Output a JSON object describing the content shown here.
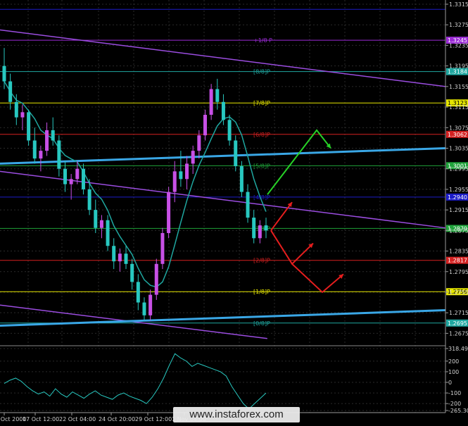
{
  "chart_data": [
    {
      "type": "candlestick",
      "instrument_panel": "price",
      "title": "",
      "ylim": [
        1.2655,
        1.3315
      ],
      "y_ticks": [
        "1.3315",
        "1.3275",
        "1.3235",
        "1.3195",
        "1.3155",
        "1.3115",
        "1.3075",
        "1.3035",
        "1.2995",
        "1.2955",
        "1.2915",
        "1.2875",
        "1.2835",
        "1.2795",
        "1.2755",
        "1.2715",
        "1.2675"
      ],
      "x_tick_labels": [
        "16 Oct 2000",
        "17 Oct 12:00",
        "22 Oct 04:00",
        "24 Oct 20:00",
        "29 Oct 12:00",
        "1 Nov 04:00"
      ],
      "price_levels": [
        {
          "label": "",
          "value": 1.3305,
          "color": "#1c1cc8",
          "badge": ""
        },
        {
          "label": "+1/8 P",
          "value": 1.3245,
          "color": "#9b2bd6",
          "badge": "1.3245"
        },
        {
          "label": "[8/8]P",
          "value": 1.3184,
          "color": "#1fa7a0",
          "badge": "1.3184"
        },
        {
          "label": "[7/8]P",
          "value": 1.3123,
          "color": "#e6e600",
          "badge": "1.3123"
        },
        {
          "label": "[6/8]P",
          "value": 1.3062,
          "color": "#d42020",
          "badge": "1.3062"
        },
        {
          "label": "[5/8]P",
          "value": 1.3001,
          "color": "#1fa33a",
          "badge": "1.3001"
        },
        {
          "label": "[4/8]P",
          "value": 1.294,
          "color": "#1c1cc8",
          "badge": "1.2940"
        },
        {
          "label": "[3/8]P",
          "value": 1.2879,
          "color": "#1fa33a",
          "badge": "1.2879"
        },
        {
          "label": "[2/8]P",
          "value": 1.2817,
          "color": "#d42020",
          "badge": "1.2817"
        },
        {
          "label": "[1/8]P",
          "value": 1.2756,
          "color": "#e6e600",
          "badge": "1.2756"
        },
        {
          "label": "[0/8]P",
          "value": 1.2695,
          "color": "#1fa7a0",
          "badge": "1.2695"
        }
      ],
      "moving_average": {
        "color": "#1fa7a0"
      },
      "candles": [
        [
          1.3195,
          1.323,
          1.315,
          1.3165
        ],
        [
          1.3165,
          1.318,
          1.311,
          1.3125
        ],
        [
          1.3125,
          1.314,
          1.308,
          1.3095
        ],
        [
          1.3095,
          1.312,
          1.307,
          1.3105
        ],
        [
          1.3105,
          1.311,
          1.304,
          1.305
        ],
        [
          1.305,
          1.3075,
          1.3005,
          1.3015
        ],
        [
          1.3015,
          1.304,
          1.299,
          1.303
        ],
        [
          1.303,
          1.3085,
          1.302,
          1.307
        ],
        [
          1.307,
          1.3095,
          1.304,
          1.305
        ],
        [
          1.305,
          1.306,
          1.298,
          1.2995
        ],
        [
          1.2995,
          1.301,
          1.295,
          1.2965
        ],
        [
          1.2965,
          1.2985,
          1.2935,
          1.2975
        ],
        [
          1.2975,
          1.301,
          1.2965,
          1.2995
        ],
        [
          1.2995,
          1.3005,
          1.2945,
          1.2955
        ],
        [
          1.2955,
          1.2975,
          1.2905,
          1.2915
        ],
        [
          1.2915,
          1.2935,
          1.287,
          1.288
        ],
        [
          1.288,
          1.2905,
          1.286,
          1.2895
        ],
        [
          1.2895,
          1.2905,
          1.2835,
          1.2845
        ],
        [
          1.2845,
          1.286,
          1.28,
          1.2815
        ],
        [
          1.2815,
          1.284,
          1.2795,
          1.283
        ],
        [
          1.283,
          1.2845,
          1.28,
          1.281
        ],
        [
          1.281,
          1.282,
          1.276,
          1.2775
        ],
        [
          1.2775,
          1.279,
          1.272,
          1.2735
        ],
        [
          1.2735,
          1.2745,
          1.27,
          1.271
        ],
        [
          1.271,
          1.276,
          1.27,
          1.275
        ],
        [
          1.275,
          1.282,
          1.274,
          1.281
        ],
        [
          1.281,
          1.288,
          1.28,
          1.287
        ],
        [
          1.287,
          1.296,
          1.286,
          1.295
        ],
        [
          1.295,
          1.301,
          1.293,
          1.299
        ],
        [
          1.299,
          1.303,
          1.296,
          1.2975
        ],
        [
          1.2975,
          1.302,
          1.2955,
          1.3005
        ],
        [
          1.3005,
          1.304,
          1.2985,
          1.303
        ],
        [
          1.303,
          1.307,
          1.3015,
          1.306
        ],
        [
          1.306,
          1.311,
          1.305,
          1.31
        ],
        [
          1.31,
          1.316,
          1.309,
          1.315
        ],
        [
          1.315,
          1.317,
          1.311,
          1.3125
        ],
        [
          1.3125,
          1.314,
          1.308,
          1.309
        ],
        [
          1.309,
          1.31,
          1.304,
          1.305
        ],
        [
          1.305,
          1.306,
          1.299,
          1.3
        ],
        [
          1.3,
          1.301,
          1.294,
          1.295
        ],
        [
          1.295,
          1.2965,
          1.289,
          1.29
        ],
        [
          1.29,
          1.2915,
          1.285,
          1.286
        ],
        [
          1.286,
          1.2895,
          1.285,
          1.2885
        ],
        [
          1.2885,
          1.29,
          1.286,
          1.2875
        ]
      ],
      "trendlines": [
        {
          "color": "#9b4de0",
          "from": [
            0,
            1.3265
          ],
          "to": [
            1,
            1.3155
          ]
        },
        {
          "color": "#9b4de0",
          "from": [
            0,
            1.299
          ],
          "to": [
            1,
            1.288
          ]
        },
        {
          "color": "#9b4de0",
          "from": [
            0,
            1.273
          ],
          "to": [
            0.6,
            1.2665
          ]
        },
        {
          "color": "#3aa7e6",
          "from": [
            0,
            1.3005
          ],
          "to": [
            1,
            1.3035
          ]
        },
        {
          "color": "#3aa7e6",
          "from": [
            0,
            1.269
          ],
          "to": [
            1,
            1.272
          ]
        }
      ],
      "scenario_arrows": [
        {
          "color": "#27d227",
          "points": [
            [
              1.2945
            ],
            [
              1.307
            ],
            [
              1.3035
            ]
          ]
        },
        {
          "color": "#e61e1e",
          "points": [
            [
              1.2875
            ],
            [
              1.293
            ]
          ]
        },
        {
          "color": "#e61e1e",
          "points": [
            [
              1.2875
            ],
            [
              1.281
            ],
            [
              1.285
            ]
          ]
        },
        {
          "color": "#e61e1e",
          "points": [
            [
              1.281
            ],
            [
              1.2755
            ],
            [
              1.279
            ]
          ]
        }
      ]
    },
    {
      "type": "line",
      "instrument_panel": "oscillator",
      "title": "",
      "ylim": [
        -265.3,
        318.5
      ],
      "y_tick_labels": [
        "318.4907",
        "200",
        "100",
        "0",
        "-100",
        "-200",
        "-265.3015"
      ],
      "series": [
        {
          "values": [
            -10,
            20,
            40,
            10,
            -40,
            -80,
            -110,
            -90,
            -130,
            -60,
            -110,
            -140,
            -90,
            -120,
            -150,
            -110,
            -80,
            -120,
            -140,
            -160,
            -120,
            -100,
            -130,
            -150,
            -170,
            -200,
            -140,
            -60,
            40,
            160,
            270,
            230,
            200,
            150,
            180,
            160,
            140,
            120,
            100,
            60,
            -40,
            -120,
            -200,
            -250,
            -200,
            -150,
            -100
          ]
        }
      ]
    }
  ],
  "watermark": "www.instaforex.com"
}
